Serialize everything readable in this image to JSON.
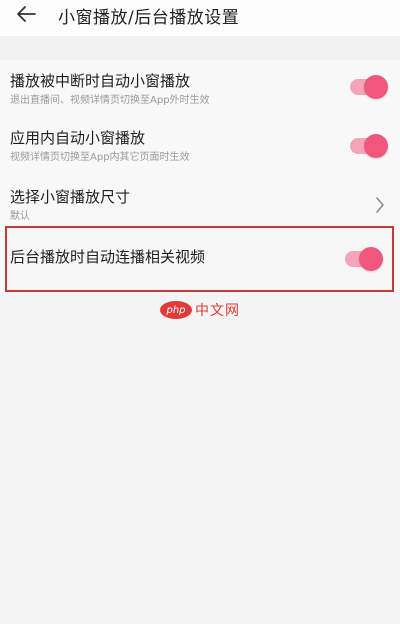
{
  "header": {
    "title": "小窗播放/后台播放设置",
    "back_icon": "arrow-left-icon"
  },
  "settings": [
    {
      "title": "播放被中断时自动小窗播放",
      "subtitle": "退出直播间、视频详情页切换至App外时生效",
      "control": "toggle",
      "checked": true
    },
    {
      "title": "应用内自动小窗播放",
      "subtitle": "视频详情页切换至App内其它页面时生效",
      "control": "toggle",
      "checked": true
    },
    {
      "title": "选择小窗播放尺寸",
      "subtitle": "默认",
      "control": "chevron"
    },
    {
      "title": "后台播放时自动连播相关视频",
      "subtitle": "",
      "control": "toggle",
      "checked": true
    }
  ],
  "colors": {
    "accent": "#f0577d",
    "track": "#f6a4ba",
    "highlight_border": "#c43a3a"
  },
  "watermark": {
    "logo": "php",
    "text": "中文网"
  }
}
